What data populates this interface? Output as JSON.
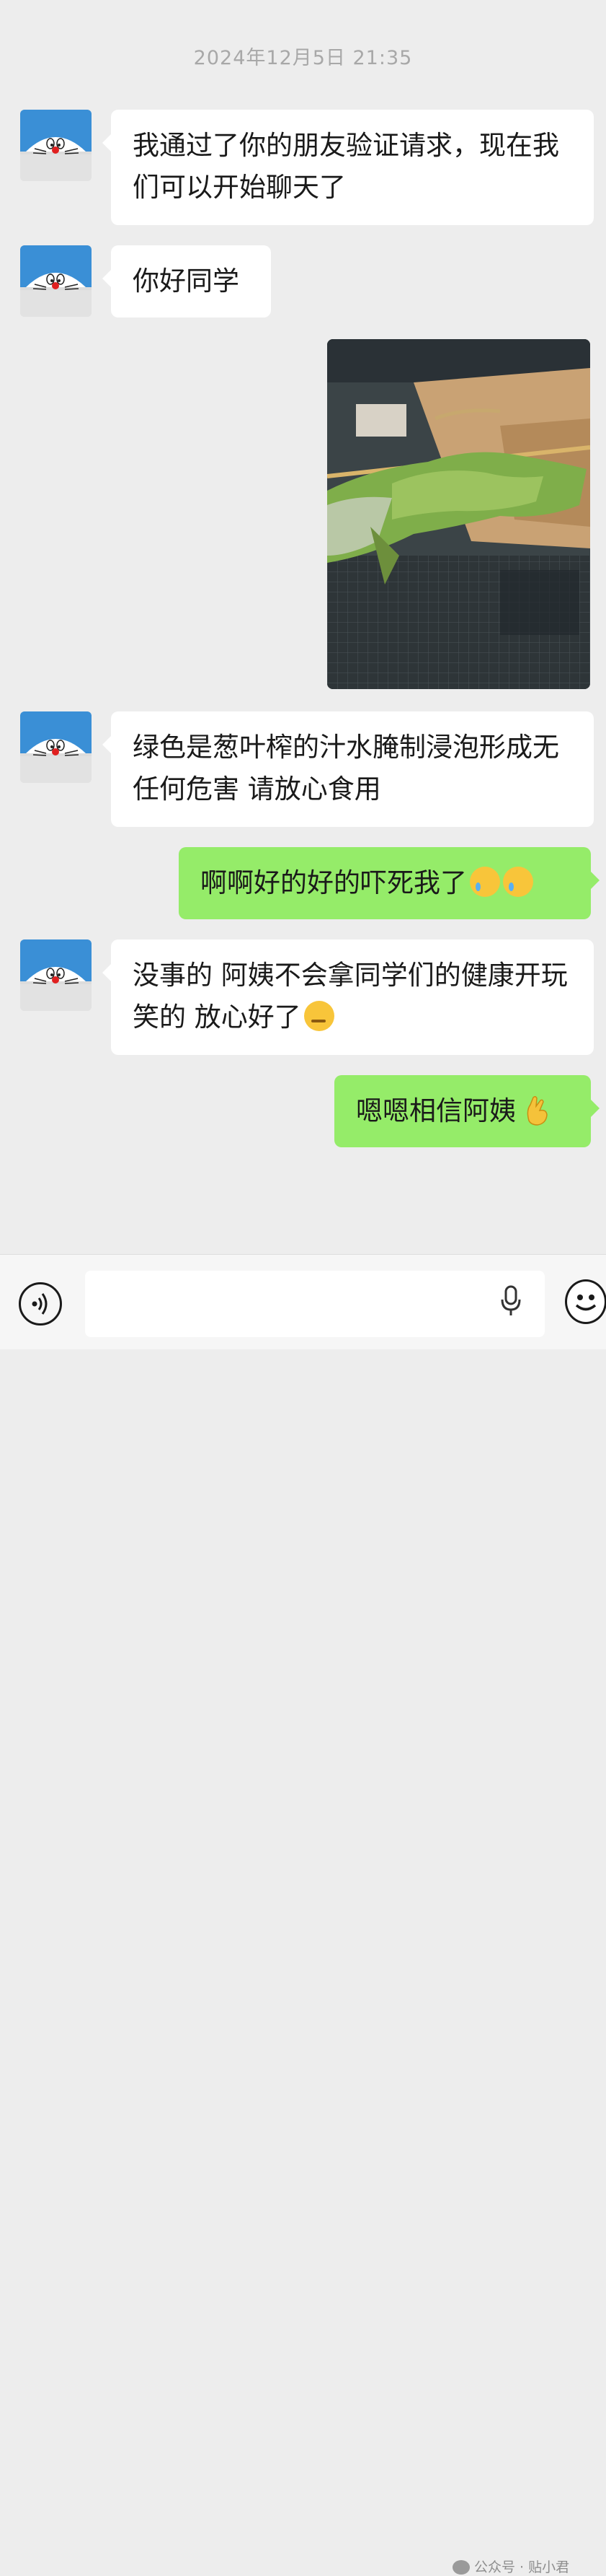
{
  "timestamp": "2024年12月5日 21:35",
  "messages": [
    {
      "text": "我通过了你的朋友验证请求，现在我们可以开始聊天了"
    },
    {
      "text": "你好同学"
    },
    {
      "text": "绿色是葱叶榨的汁水腌制浸泡形成无任何危害 请放心食用"
    },
    {
      "text": "啊啊好的好的吓死我了"
    },
    {
      "text": "没事的 阿姨不会拿同学们的健康开玩笑的 放心好了"
    },
    {
      "text": "嗯嗯相信阿姨"
    }
  ],
  "emojis": [
    "crying-smile",
    "crying-smile",
    "thinking-face",
    "ok-hand"
  ],
  "colors": {
    "incoming_bubble": "#ffffff",
    "outgoing_bubble": "#95ec69",
    "background": "#ededed",
    "avatar": "#3a8fd6"
  },
  "watermark": "公众号 · 贴小君"
}
